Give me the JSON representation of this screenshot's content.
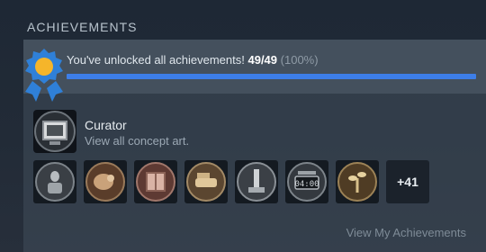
{
  "section": {
    "title": "ACHIEVEMENTS"
  },
  "progress": {
    "message": "You've unlocked all achievements!",
    "count": "49/49",
    "percent_text": "(100%)",
    "fraction": 1.0,
    "bar_color": "#3d7ee8"
  },
  "featured": {
    "name": "Curator",
    "description": "View all concept art.",
    "icon": "framed-painting-icon"
  },
  "thumbnails": [
    {
      "icon": "statue-icon"
    },
    {
      "icon": "creature-icon"
    },
    {
      "icon": "box-icon"
    },
    {
      "icon": "hand-icon"
    },
    {
      "icon": "lever-icon"
    },
    {
      "icon": "clock-icon"
    },
    {
      "icon": "plant-icon"
    }
  ],
  "more": {
    "label": "+41"
  },
  "footer": {
    "link_label": "View My Achievements"
  },
  "colors": {
    "accent": "#3d7ee8",
    "medal_gold": "#f5b52a",
    "medal_blue": "#2f80d8"
  }
}
